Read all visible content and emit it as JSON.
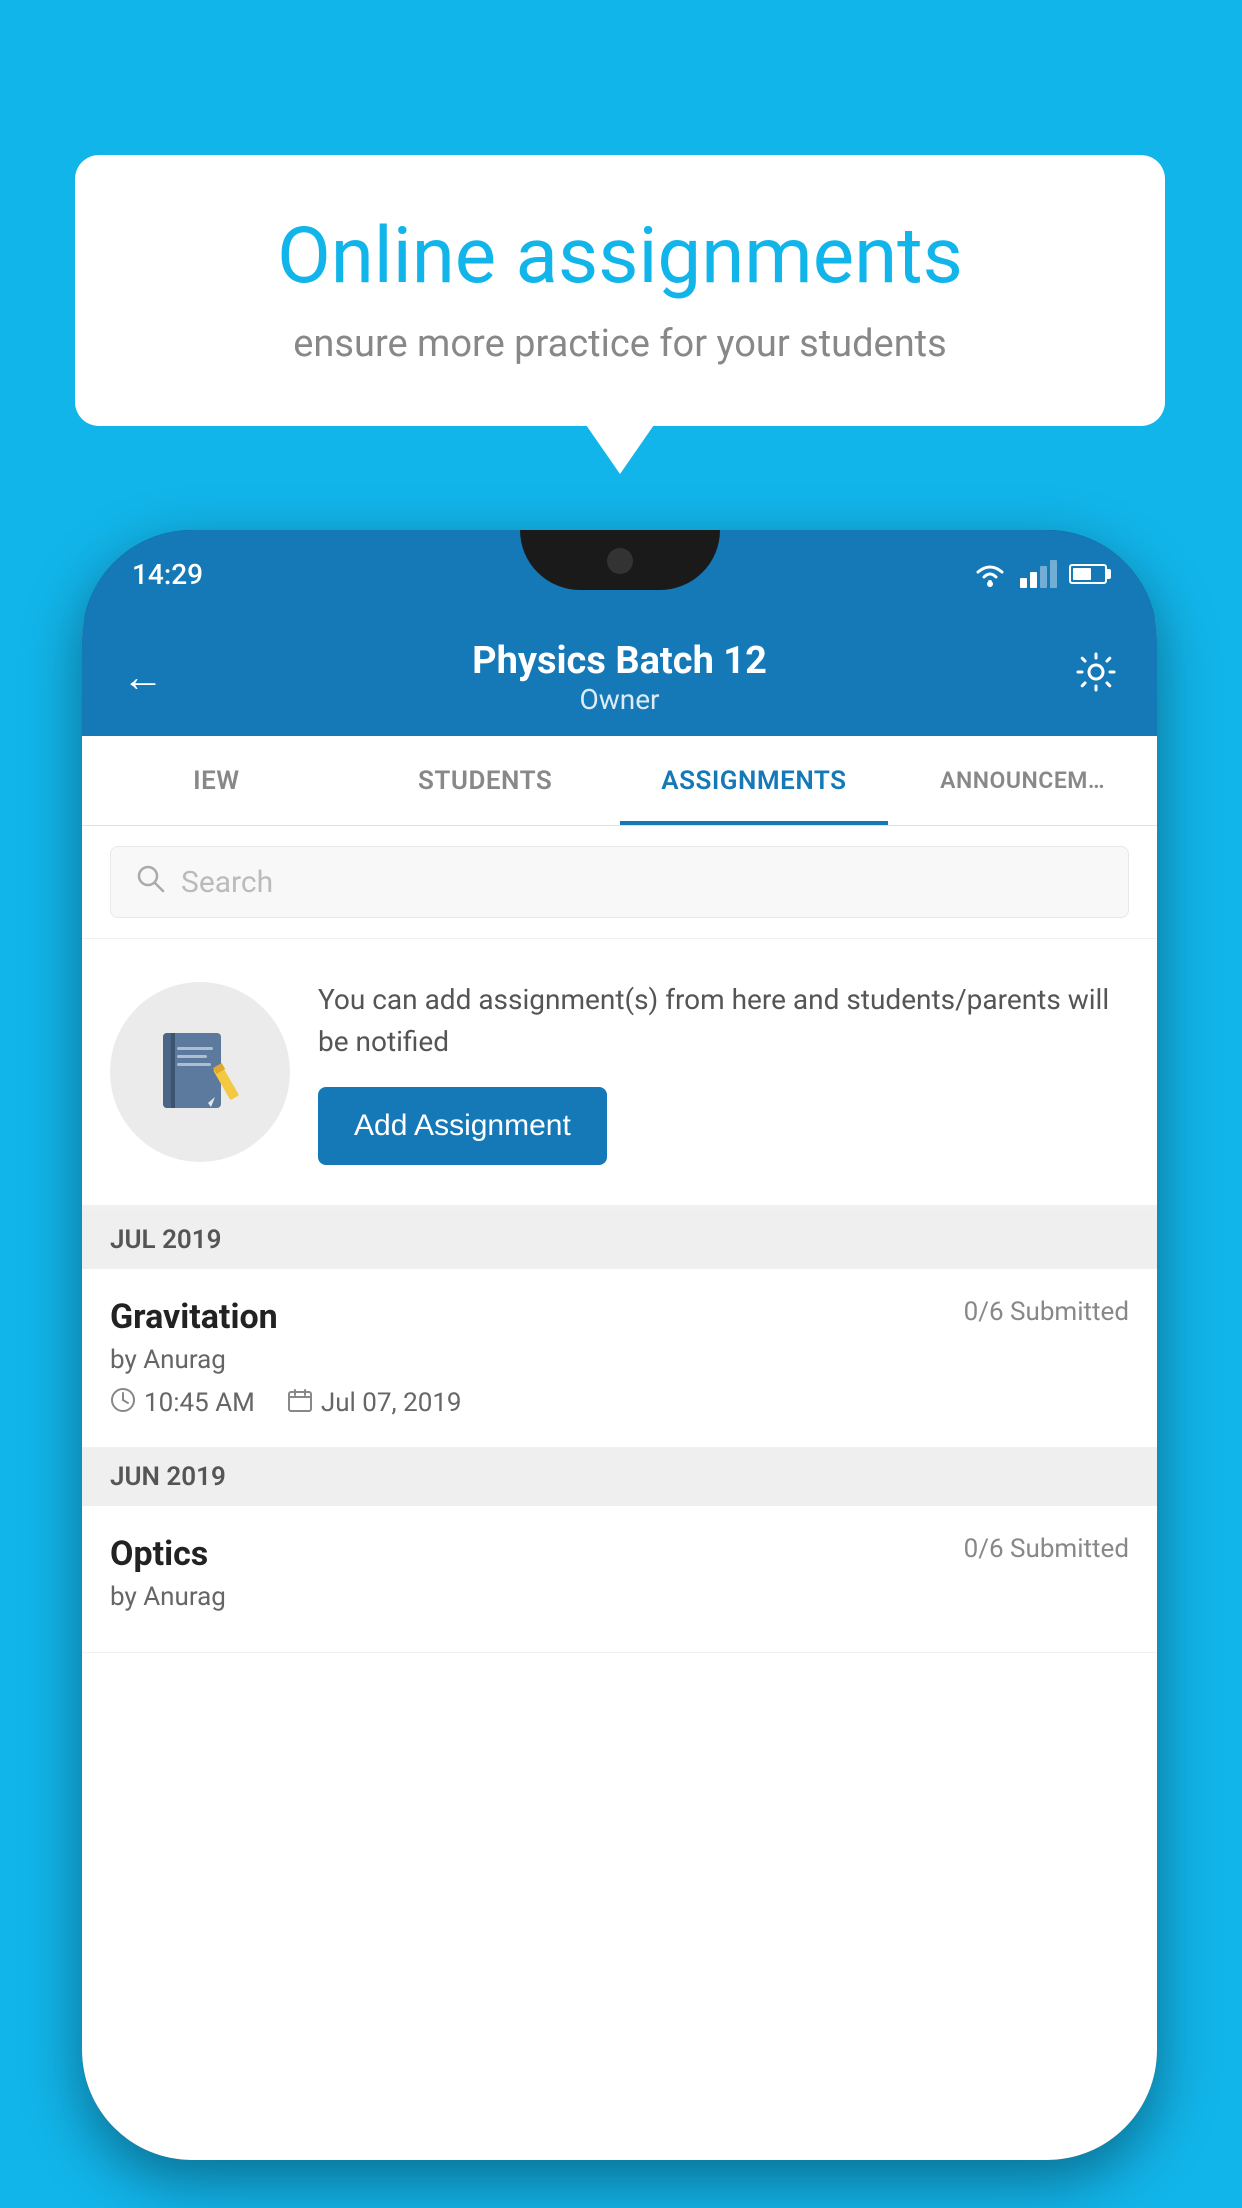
{
  "page": {
    "background_color": "#12B5EA"
  },
  "tooltip": {
    "title": "Online assignments",
    "subtitle": "ensure more practice for your students"
  },
  "phone": {
    "status_bar": {
      "time": "14:29"
    },
    "header": {
      "title": "Physics Batch 12",
      "subtitle": "Owner",
      "back_label": "←",
      "settings_label": "⚙"
    },
    "tabs": [
      {
        "label": "IEW",
        "active": false
      },
      {
        "label": "STUDENTS",
        "active": false
      },
      {
        "label": "ASSIGNMENTS",
        "active": true
      },
      {
        "label": "ANNOUNCEM…",
        "active": false
      }
    ],
    "search": {
      "placeholder": "Search"
    },
    "empty_state": {
      "description": "You can add assignment(s) from here and students/parents will be notified",
      "button_label": "Add Assignment"
    },
    "sections": [
      {
        "month_label": "JUL 2019",
        "assignments": [
          {
            "name": "Gravitation",
            "submitted": "0/6 Submitted",
            "by": "by Anurag",
            "time": "10:45 AM",
            "date": "Jul 07, 2019"
          }
        ]
      },
      {
        "month_label": "JUN 2019",
        "assignments": [
          {
            "name": "Optics",
            "submitted": "0/6 Submitted",
            "by": "by Anurag",
            "time": "",
            "date": ""
          }
        ]
      }
    ]
  }
}
